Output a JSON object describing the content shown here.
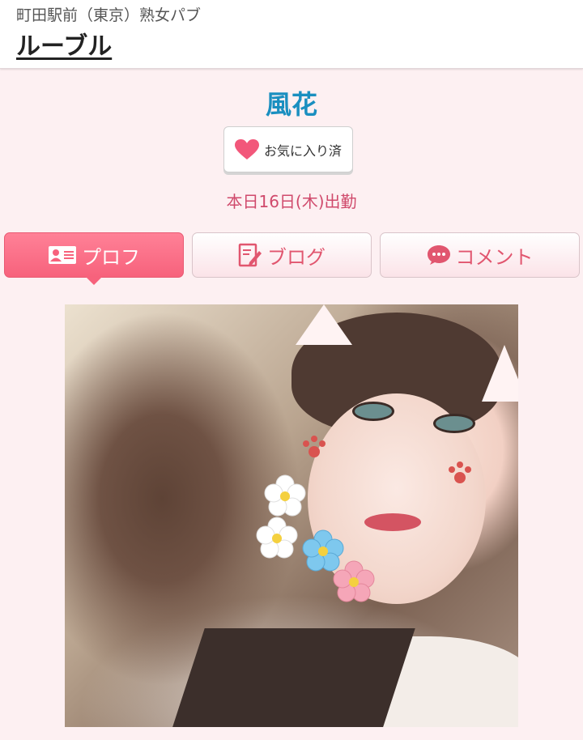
{
  "header": {
    "subtitle": "町田駅前（東京）熟女パブ",
    "shop_name": "ルーブル"
  },
  "profile": {
    "name": "風花",
    "favorite_label": "お気に入り済",
    "attendance": "本日16日(木)出勤"
  },
  "tabs": [
    {
      "label": "プロフ",
      "icon": "id-card-icon",
      "active": true
    },
    {
      "label": "ブログ",
      "icon": "edit-note-icon",
      "active": false
    },
    {
      "label": "コメント",
      "icon": "speech-bubble-icon",
      "active": false
    }
  ],
  "colors": {
    "accent": "#f7627c",
    "name": "#1a8fc0",
    "attendance": "#d04a6c",
    "background": "#fdf0f2"
  },
  "photo": {
    "alt": "profile-photo"
  }
}
